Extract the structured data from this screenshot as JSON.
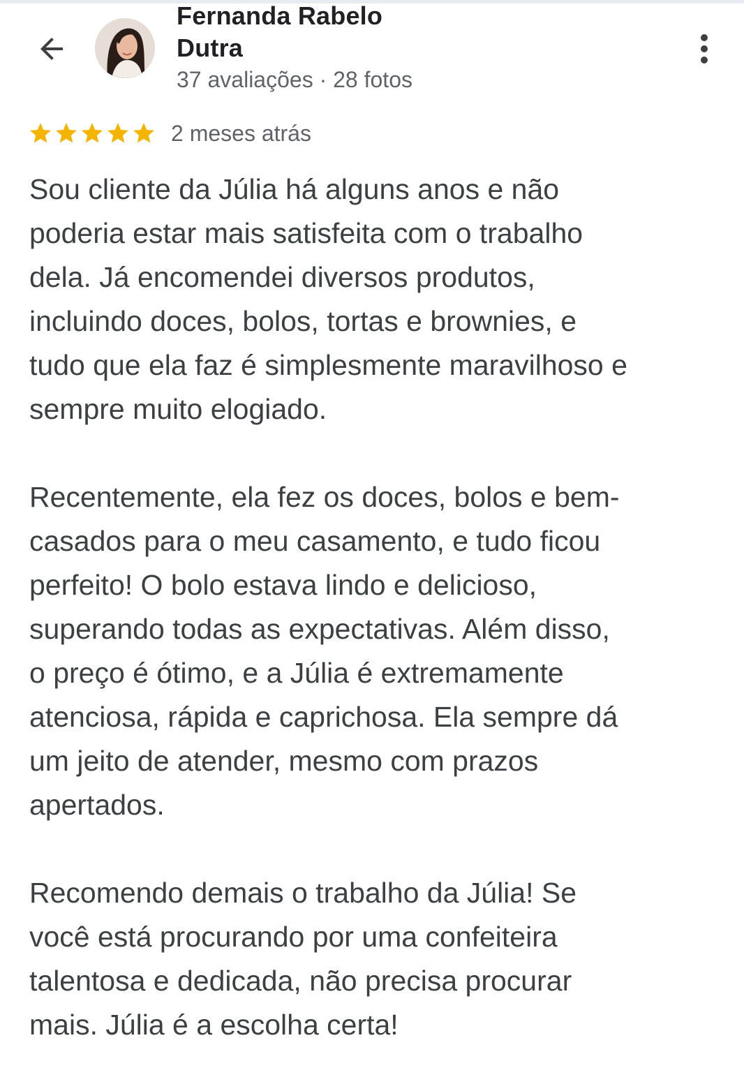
{
  "header": {
    "back_icon": "arrow-left-icon",
    "reviewer_name": "Fernanda Rabelo\nDutra",
    "stats": "37 avaliações · 28 fotos",
    "more_icon": "more-vert-icon"
  },
  "review": {
    "rating": 5,
    "max_rating": 5,
    "star_color": "#f5b400",
    "date": "2 meses atrás",
    "paragraphs": [
      "Sou cliente da Júlia há alguns anos e não\npoderia estar mais satisfeita com o trabalho\ndela. Já encomendei diversos produtos,\nincluindo doces, bolos, tortas e brownies, e\ntudo que ela faz é simplesmente maravilhoso e\nsempre muito elogiado.",
      "Recentemente, ela fez os doces, bolos e bem-\ncasados para o meu casamento, e tudo ficou\nperfeito! O bolo estava lindo e delicioso,\nsuperando todas as expectativas. Além disso,\no preço é ótimo, e a Júlia é extremamente\natenciosa, rápida e caprichosa. Ela sempre dá\num jeito de atender, mesmo com prazos\napertados.",
      "Recomendo demais o trabalho da Júlia! Se\nvocê está procurando por uma confeiteira\ntalentosa e dedicada, não precisa procurar\nmais. Júlia é a escolha certa!"
    ]
  }
}
